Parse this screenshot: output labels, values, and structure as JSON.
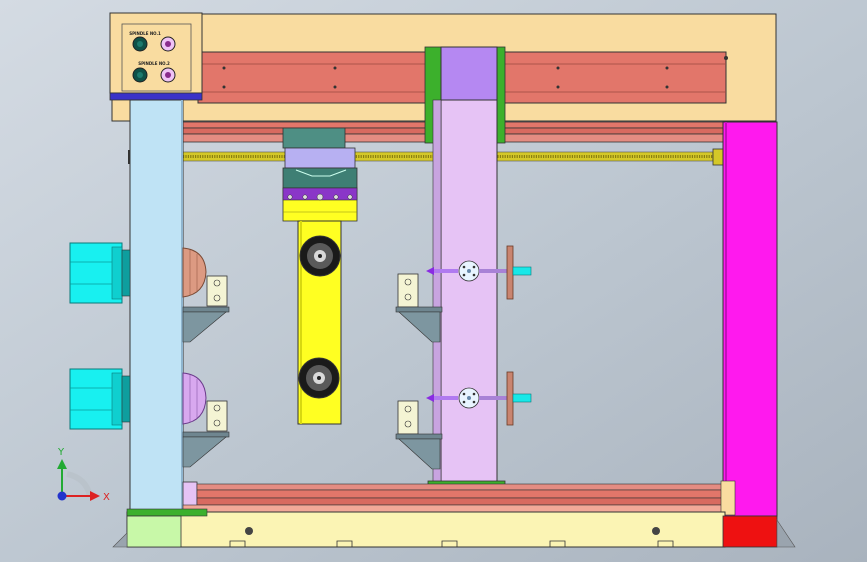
{
  "panel": {
    "label_top": "SPINDLE NO.1",
    "label_bottom": "SPINDLE NO.2"
  },
  "axes": {
    "y_label": "Y",
    "x_label": "X",
    "y_color": "#22aa33",
    "x_color": "#dd2222",
    "origin_color": "#2233cc"
  },
  "colors": {
    "frame": "#f9dca0",
    "rail": "#e2766a",
    "left_column": "#bfe3f5",
    "gantry": "#e6c3f5",
    "right_column": "#ff19ee",
    "carriage_arm": "#ffff22",
    "motor": "#18f0f0",
    "ballscrew": "#d4c828",
    "base": "#fbf4b4",
    "green_plate": "#3cb02c",
    "red_foot": "#ee1111"
  }
}
